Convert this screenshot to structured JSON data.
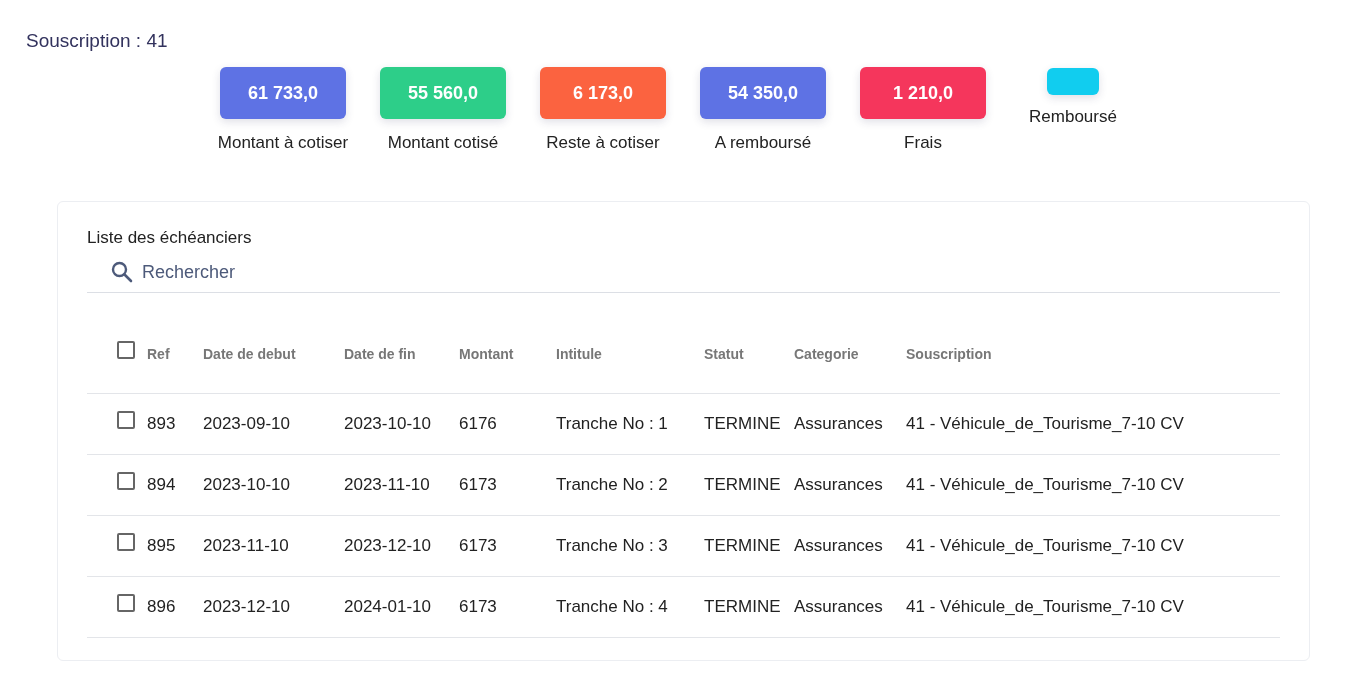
{
  "title": "Souscription : 41",
  "stats": [
    {
      "value": "61 733,0",
      "label": "Montant à cotiser",
      "color": "#5e72e4"
    },
    {
      "value": "55 560,0",
      "label": "Montant cotisé",
      "color": "#2dce89"
    },
    {
      "value": "6 173,0",
      "label": "Reste à cotiser",
      "color": "#fb6340"
    },
    {
      "value": "54 350,0",
      "label": "A remboursé",
      "color": "#5e72e4"
    },
    {
      "value": "1 210,0",
      "label": "Frais",
      "color": "#f5365c"
    },
    {
      "label": "Remboursé",
      "color": "#11cdef"
    }
  ],
  "table": {
    "title": "Liste des échéanciers",
    "search": {
      "placeholder": "Rechercher"
    },
    "select_all": {
      "checked": false
    },
    "columns": [
      "Ref",
      "Date de debut",
      "Date de fin",
      "Montant",
      "Intitule",
      "Statut",
      "Categorie",
      "Souscription"
    ],
    "rows": [
      {
        "checked": false,
        "cells": [
          "893",
          "2023-09-10",
          "2023-10-10",
          "6176",
          "Tranche No : 1",
          "TERMINE",
          "Assurances",
          "41 - Véhicule_de_Tourisme_7-10 CV"
        ]
      },
      {
        "checked": false,
        "cells": [
          "894",
          "2023-10-10",
          "2023-11-10",
          "6173",
          "Tranche No : 2",
          "TERMINE",
          "Assurances",
          "41 - Véhicule_de_Tourisme_7-10 CV"
        ]
      },
      {
        "checked": false,
        "cells": [
          "895",
          "2023-11-10",
          "2023-12-10",
          "6173",
          "Tranche No : 3",
          "TERMINE",
          "Assurances",
          "41 - Véhicule_de_Tourisme_7-10 CV"
        ]
      },
      {
        "checked": false,
        "cells": [
          "896",
          "2023-12-10",
          "2024-01-10",
          "6173",
          "Tranche No : 4",
          "TERMINE",
          "Assurances",
          "41 - Véhicule_de_Tourisme_7-10 CV"
        ]
      }
    ]
  }
}
